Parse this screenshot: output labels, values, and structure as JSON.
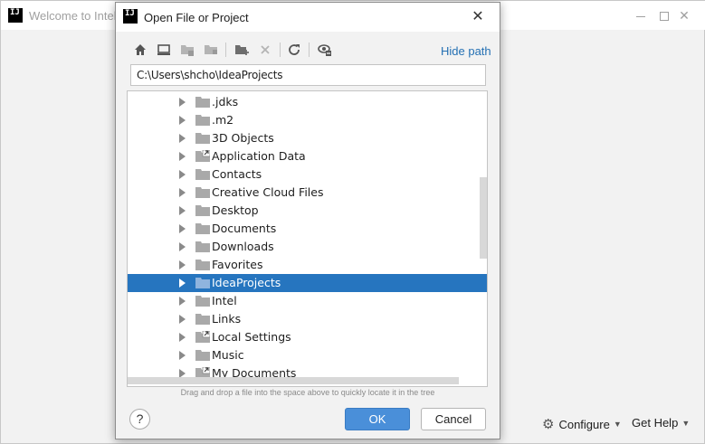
{
  "background": {
    "title": "Welcome to IntelliJ IDEA",
    "configure_label": "Configure",
    "get_help_label": "Get Help"
  },
  "dialog": {
    "title": "Open File or Project",
    "hide_path_label": "Hide path",
    "path_value": "C:\\Users\\shcho\\IdeaProjects",
    "hint": "Drag and drop a file into the space above to quickly locate it in the tree",
    "ok_label": "OK",
    "cancel_label": "Cancel",
    "help_label": "?"
  },
  "toolbar_icons": [
    "home-icon",
    "desktop-icon",
    "project-directory-icon",
    "module-directory-icon",
    "new-folder-icon",
    "delete-icon",
    "refresh-icon",
    "show-hidden-icon"
  ],
  "tree": {
    "items": [
      {
        "label": ".jdks",
        "shortcut": false
      },
      {
        "label": ".m2",
        "shortcut": false
      },
      {
        "label": "3D Objects",
        "shortcut": false
      },
      {
        "label": "Application Data",
        "shortcut": true
      },
      {
        "label": "Contacts",
        "shortcut": false
      },
      {
        "label": "Creative Cloud Files",
        "shortcut": false
      },
      {
        "label": "Desktop",
        "shortcut": false
      },
      {
        "label": "Documents",
        "shortcut": false
      },
      {
        "label": "Downloads",
        "shortcut": false
      },
      {
        "label": "Favorites",
        "shortcut": false
      },
      {
        "label": "IdeaProjects",
        "shortcut": false,
        "selected": true
      },
      {
        "label": "Intel",
        "shortcut": false
      },
      {
        "label": "Links",
        "shortcut": false
      },
      {
        "label": "Local Settings",
        "shortcut": true
      },
      {
        "label": "Music",
        "shortcut": false
      },
      {
        "label": "My Documents",
        "shortcut": true
      }
    ]
  },
  "colors": {
    "selection": "#2675bf",
    "link": "#2470b3",
    "ok_button": "#4a8fd9"
  }
}
